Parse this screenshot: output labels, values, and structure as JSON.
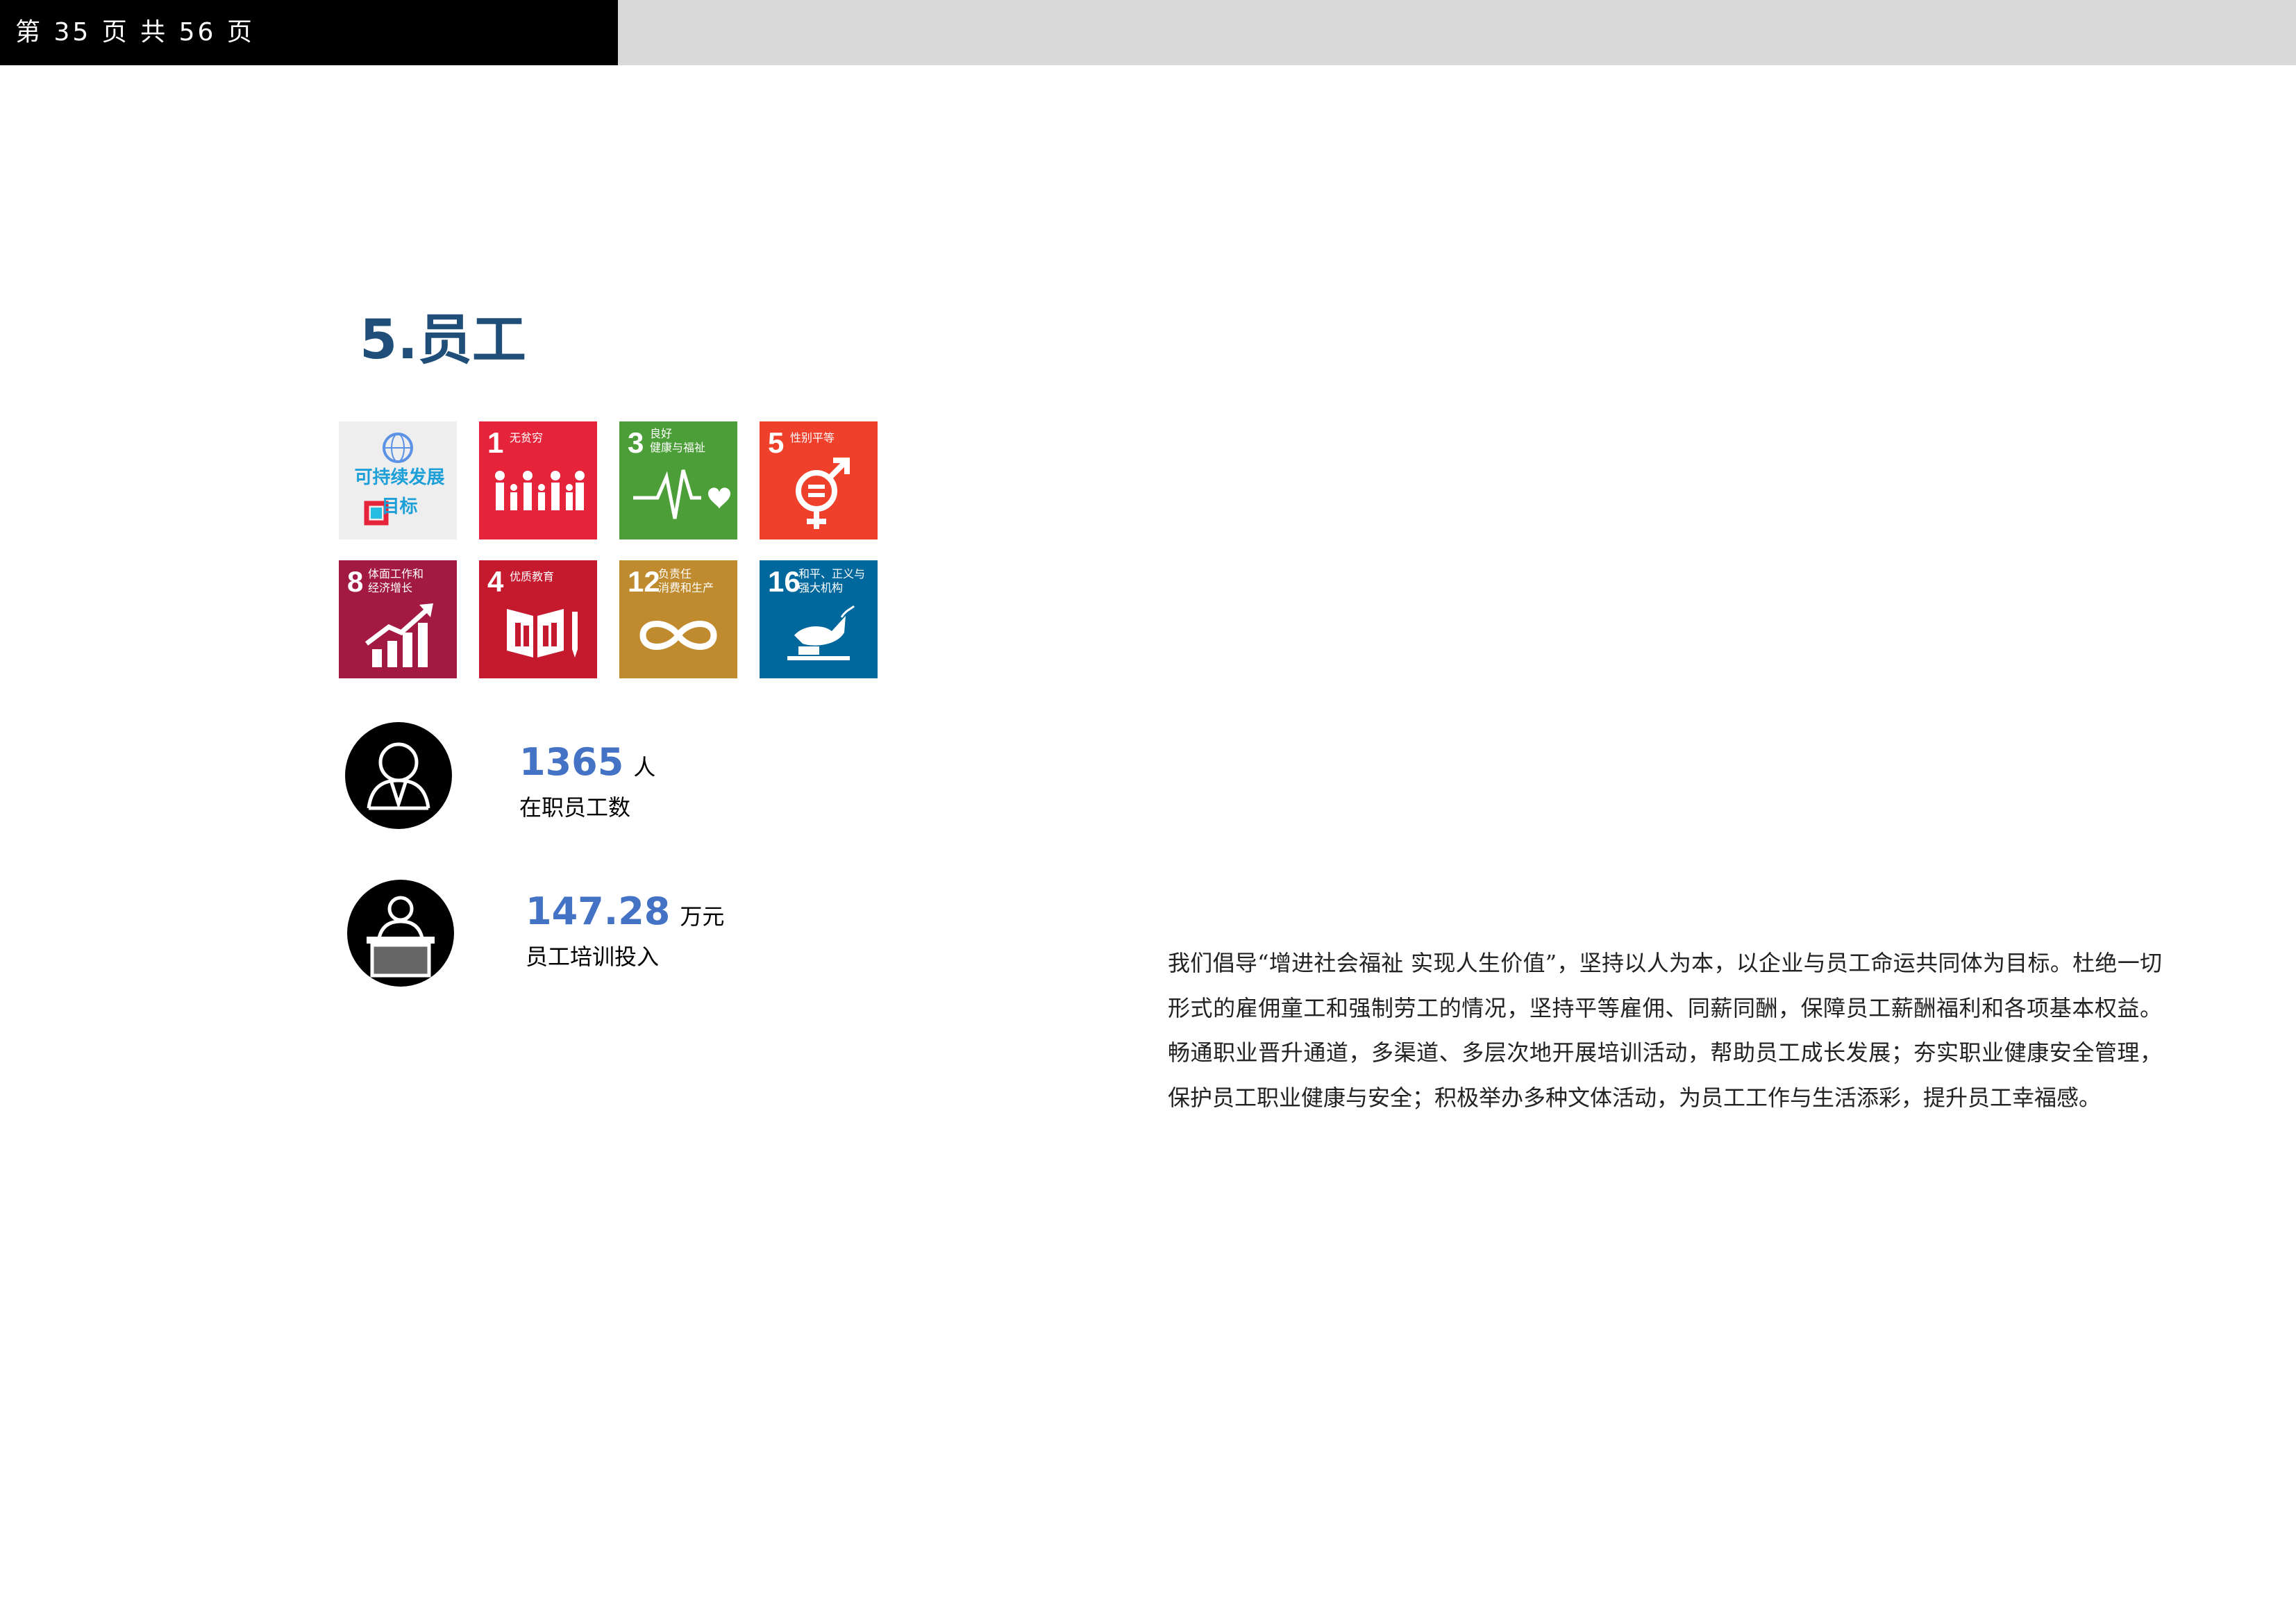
{
  "header": {
    "page_indicator": "第 35 页 共 56 页"
  },
  "section": {
    "title": "5.员工"
  },
  "sdg_tiles": [
    {
      "icon": "un-sdg-logo-icon",
      "label": "可持续发展\n目标",
      "color": "#eeeeee"
    },
    {
      "number": "1",
      "label": "无贫穷",
      "icon": "family-people-icon",
      "color": "#e5243b"
    },
    {
      "number": "3",
      "label": "良好\n健康与福祉",
      "icon": "heartbeat-icon",
      "color": "#4c9f38"
    },
    {
      "number": "5",
      "label": "性别平等",
      "icon": "gender-equality-icon",
      "color": "#ef402b"
    },
    {
      "number": "8",
      "label": "体面工作和\n经济增长",
      "icon": "growth-chart-icon",
      "color": "#a21942"
    },
    {
      "number": "4",
      "label": "优质教育",
      "icon": "book-pencil-icon",
      "color": "#c5192d"
    },
    {
      "number": "12",
      "label": "负责任\n消费和生产",
      "icon": "infinity-icon",
      "color": "#bf8b2e"
    },
    {
      "number": "16",
      "label": "和平、正义与\n强大机构",
      "icon": "dove-gavel-icon",
      "color": "#00689d"
    }
  ],
  "stats": [
    {
      "value": "1365",
      "unit": "人",
      "label": "在职员工数",
      "icon": "employee-person-icon"
    },
    {
      "value": "147.28",
      "unit": "万元",
      "label": "员工培训投入",
      "icon": "trainer-podium-icon"
    }
  ],
  "body": {
    "paragraph": "我们倡导“增进社会福祉 实现人生价值”，坚持以人为本，以企业与员工命运共同体为目标。杜绝一切形式的雇佣童工和强制劳工的情况，坚持平等雇佣、同薪同酬，保障员工薪酬福利和各项基本权益。畅通职业晋升通道，多渠道、多层次地开展培训活动，帮助员工成长发展；夯实职业健康安全管理，保护员工职业健康与安全；积极举办多种文体活动，为员工工作与生活添彩，提升员工幸福感。"
  }
}
